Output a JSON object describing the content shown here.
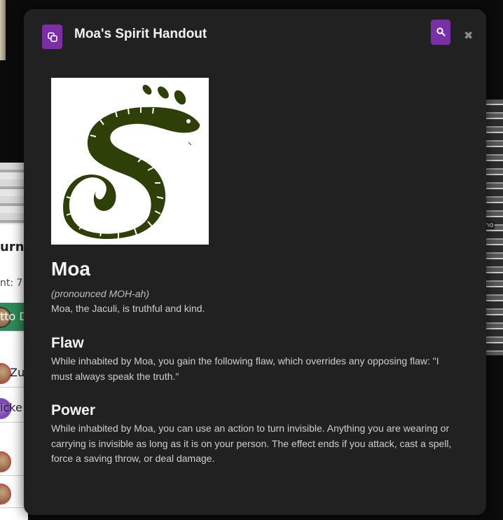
{
  "background": {
    "tracker": {
      "title": "urn",
      "round_text": "nt: 7",
      "rows": [
        {
          "name": "tto D",
          "active": true
        },
        {
          "name": "Zu",
          "active": false
        },
        {
          "name": "icke",
          "active": false
        },
        {
          "name": "",
          "active": false
        },
        {
          "name": "",
          "active": false
        }
      ]
    },
    "map_label": "no"
  },
  "modal": {
    "title": "Moa's Spirit Handout",
    "icons": {
      "title_icon": "handout-icon",
      "search": "search-icon",
      "close": "close-icon"
    },
    "close_glyph": "✖",
    "portrait_alt": "jaculi-serpent-image",
    "name": "Moa",
    "pronunciation": "(pronounced MOH-ah)",
    "description": "Moa, the Jaculi, is truthful and kind.",
    "sections": [
      {
        "heading": "Flaw",
        "text": "While inhabited by Moa, you gain the following flaw, which overrides any opposing flaw: \"I must always speak the truth.\""
      },
      {
        "heading": "Power",
        "text": "While inhabited by Moa, you can use an action to turn invisible. Anything you are wearing or carrying is invisible as long as it is on your person. The effect ends if you attack, cast a spell, force a saving throw, or deal damage."
      }
    ]
  },
  "colors": {
    "modal_bg": "#212121",
    "accent": "#7b2fa6",
    "serpent": "#2f3f08",
    "active_row": "#2e8b57"
  }
}
